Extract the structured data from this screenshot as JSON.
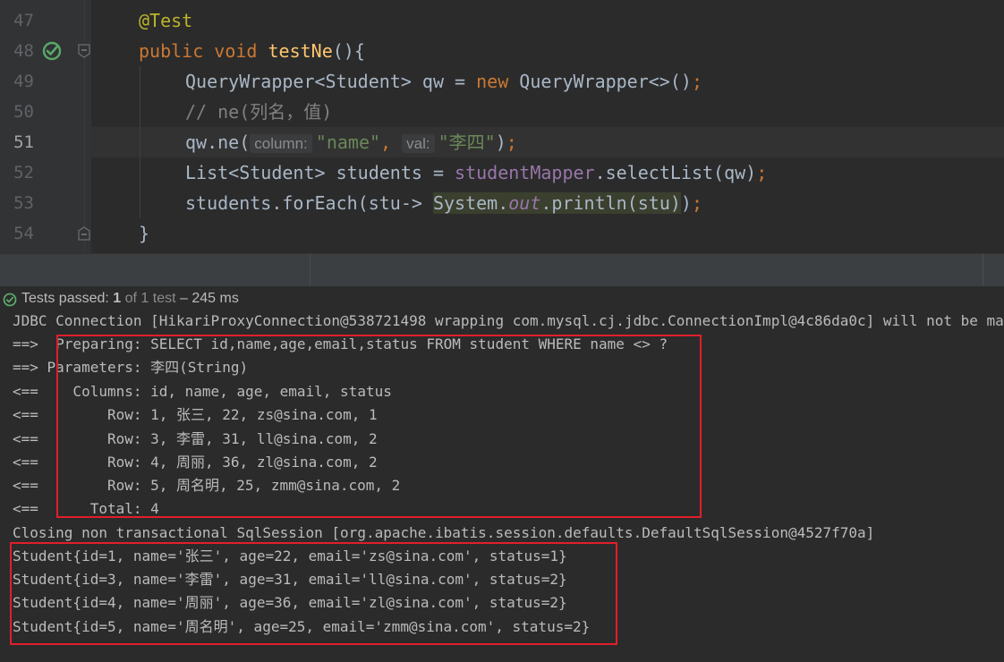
{
  "editor": {
    "lines": [
      {
        "num": "47"
      },
      {
        "num": "48"
      },
      {
        "num": "49"
      },
      {
        "num": "50"
      },
      {
        "num": "51"
      },
      {
        "num": "52"
      },
      {
        "num": "53"
      },
      {
        "num": "54"
      }
    ],
    "code": {
      "l47_ann": "@Test",
      "l48_public": "public",
      "l48_void": "void",
      "l48_fn": "testNe",
      "l48_rest": "(){",
      "l49_a": "QueryWrapper<Student> qw = ",
      "l49_new": "new",
      "l49_b": " QueryWrapper<>()",
      "l49_semi": ";",
      "l50_comment": "// ne(列名，值)",
      "l51_a": "qw.ne(",
      "l51_hint1": "column:",
      "l51_str1": "\"name\"",
      "l51_comma": ",",
      "l51_hint2": "val:",
      "l51_str2": "\"李四\"",
      "l51_close": ")",
      "l51_semi": ";",
      "l52_a": "List<Student> students = ",
      "l52_fld": "studentMapper",
      "l52_b": ".selectList(qw)",
      "l52_semi": ";",
      "l53_a": "students.forEach(stu-> ",
      "l53_sys": "System.",
      "l53_out": "out",
      "l53_b": ".println(stu)",
      "l53_c": ")",
      "l53_semi": ";",
      "l54_brace": "}"
    }
  },
  "test_status": {
    "label": "Tests passed:",
    "passed": "1",
    "of_total": "of 1 test",
    "duration": "– 245 ms"
  },
  "console": {
    "lines": [
      "JDBC Connection [HikariProxyConnection@538721498 wrapping com.mysql.cj.jdbc.ConnectionImpl@4c86da0c] will not be managed by Spring",
      "==>  Preparing: SELECT id,name,age,email,status FROM student WHERE name <> ?",
      "==> Parameters: 李四(String)",
      "<==    Columns: id, name, age, email, status",
      "<==        Row: 1, 张三, 22, zs@sina.com, 1",
      "<==        Row: 3, 李雷, 31, ll@sina.com, 2",
      "<==        Row: 4, 周丽, 36, zl@sina.com, 2",
      "<==        Row: 5, 周名明, 25, zmm@sina.com, 2",
      "<==      Total: 4",
      "Closing non transactional SqlSession [org.apache.ibatis.session.defaults.DefaultSqlSession@4527f70a]",
      "Student{id=1, name='张三', age=22, email='zs@sina.com', status=1}",
      "Student{id=3, name='李雷', age=31, email='ll@sina.com', status=2}",
      "Student{id=4, name='周丽', age=36, email='zl@sina.com', status=2}",
      "Student{id=5, name='周名明', age=25, email='zmm@sina.com', status=2}"
    ]
  },
  "colors": {
    "highlight_box": "#e01f2b",
    "run_icon": "#59a869"
  }
}
